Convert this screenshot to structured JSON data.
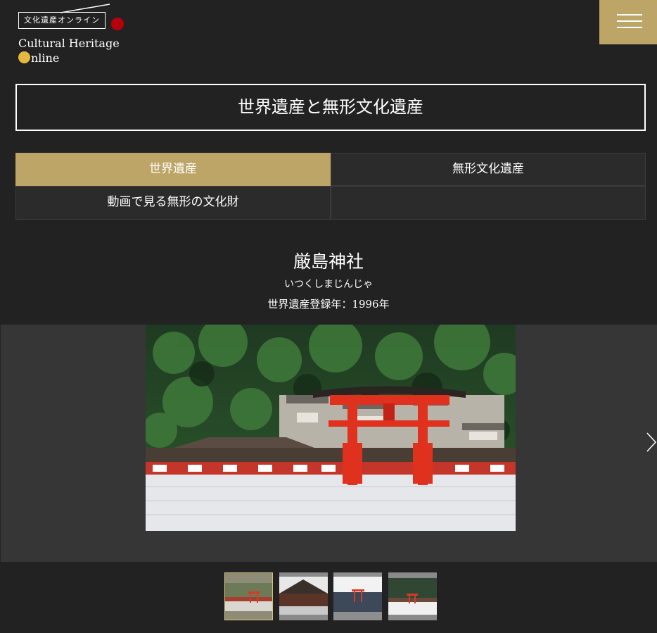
{
  "logo": {
    "jp": "文化遺産オンライン",
    "en_line1": "Cultural Heritage",
    "en_line2": "nline"
  },
  "header": {
    "menu_icon": "hamburger-menu-icon"
  },
  "page_title": "世界遺産と無形文化遺産",
  "tabs": [
    {
      "label": "世界遺産",
      "active": true
    },
    {
      "label": "無形文化遺産",
      "active": false
    },
    {
      "label": "動画で見る無形の文化財",
      "active": false
    }
  ],
  "site": {
    "name": "厳島神社",
    "reading": "いつくしまじんじゃ",
    "year": "世界遺産登録年：1996年"
  },
  "slider": {
    "next_icon": "chevron-right-icon"
  },
  "thumbnails": [
    {
      "active": true
    },
    {
      "active": false
    },
    {
      "active": false
    },
    {
      "active": false
    }
  ],
  "colors": {
    "accent": "#bca566",
    "background": "#222222",
    "logo_red": "#b8000b",
    "logo_yellow": "#e5b93f"
  }
}
